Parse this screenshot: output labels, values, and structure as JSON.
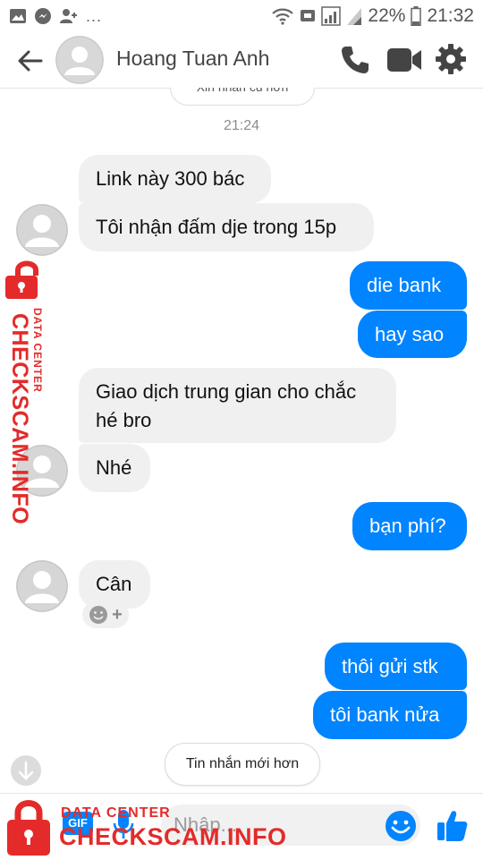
{
  "status_bar": {
    "battery_text": "22%",
    "time": "21:32",
    "overflow": "..."
  },
  "header": {
    "contact_name": "Hoang Tuan Anh"
  },
  "conversation": {
    "cut_off_pill": "Xin nhắn cũ hơn",
    "timestamp": "21:24",
    "messages": [
      {
        "side": "in",
        "text": "Link này 300 bác"
      },
      {
        "side": "in",
        "text": "Tôi nhận đấm dje trong 15p"
      },
      {
        "side": "out",
        "text": "die bank"
      },
      {
        "side": "out",
        "text": "hay sao"
      },
      {
        "side": "in",
        "text": "Giao dịch trung gian cho chắc hé bro"
      },
      {
        "side": "in",
        "text": "Nhé"
      },
      {
        "side": "out",
        "text": "bạn phí?"
      },
      {
        "side": "in",
        "text": "Cân"
      },
      {
        "side": "out",
        "text": "thôi gửi stk"
      },
      {
        "side": "out",
        "text": "tôi bank nửa"
      }
    ],
    "newer_messages_label": "Tin nhắn mới hơn",
    "reaction_plus": "+"
  },
  "composer": {
    "gif_label": "GIF",
    "placeholder": "Nhập..."
  },
  "watermark": {
    "brand": "CHECKSCAM.INFO",
    "sub": "DATA CENTER"
  },
  "colors": {
    "messenger_blue": "#0084ff",
    "incoming_bubble": "#f1f0f0",
    "watermark_red": "#e42a2a"
  }
}
